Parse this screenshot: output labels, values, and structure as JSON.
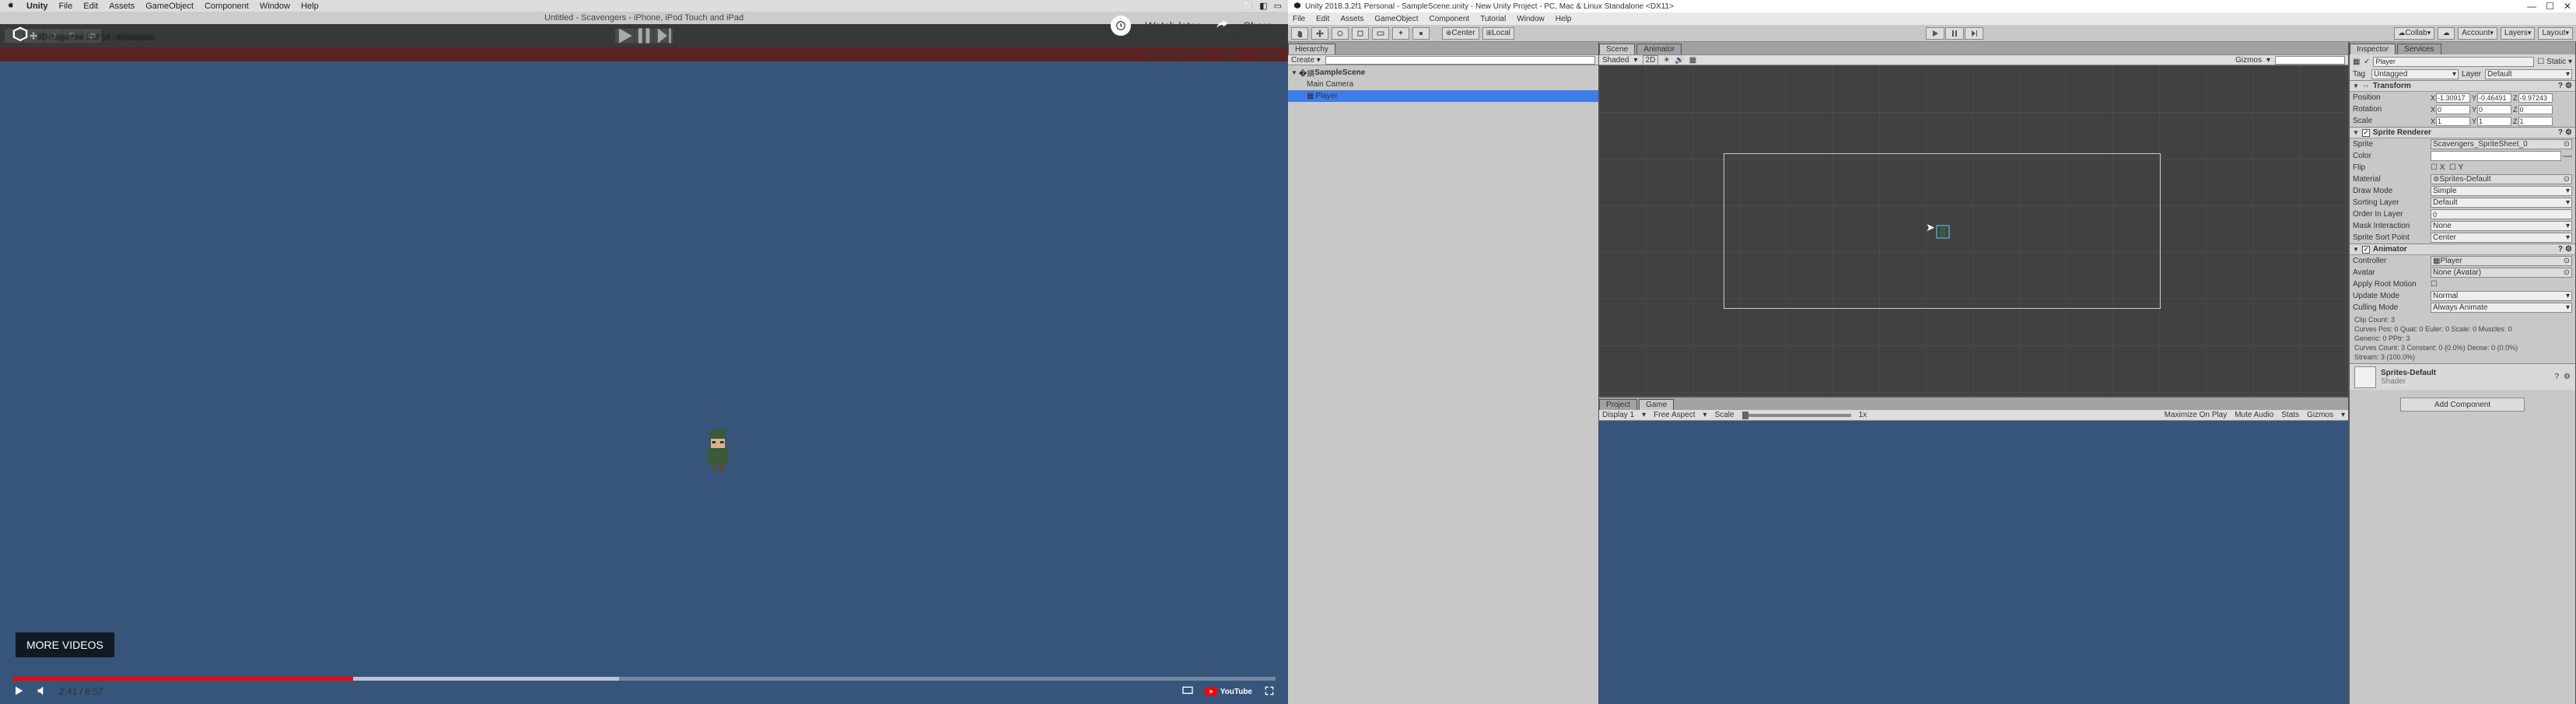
{
  "mac_menu": {
    "app": "Unity",
    "items": [
      "File",
      "Edit",
      "Assets",
      "GameObject",
      "Component",
      "Window",
      "Help"
    ]
  },
  "mac_doc_title": "Untitled - Scavengers - iPhone, iPod Touch and iPad",
  "video": {
    "title": "2D Roguelike 2 of 14 : Animations",
    "watch_later": "Watch later",
    "share": "Share",
    "more_videos": "MORE VIDEOS",
    "time": "2:41 / 8:57",
    "youtube": "YouTube"
  },
  "left_toolbar_right": [
    "Layers",
    "Layout"
  ],
  "red_bar": {
    "left": "",
    "right1": "Maximize on Play",
    "right2": "Stats",
    "right3": "Gizmos"
  },
  "win_title": "Unity 2018.3.2f1 Personal - SampleScene.unity - New Unity Project - PC, Mac & Linux Standalone <DX11>",
  "win_menu": [
    "File",
    "Edit",
    "Assets",
    "GameObject",
    "Component",
    "Tutorial",
    "Window",
    "Help"
  ],
  "main_toolbar": {
    "center": "Center",
    "local": "Local",
    "collab": "Collab",
    "account": "Account",
    "layers": "Layers",
    "layout": "Layout"
  },
  "hierarchy": {
    "tab": "Hierarchy",
    "create": "Create",
    "scene": "SampleScene",
    "items": [
      "Main Camera",
      "Player"
    ]
  },
  "scene_tabs": {
    "scene": "Scene",
    "animator": "Animator"
  },
  "scene_toolbar": {
    "shaded": "Shaded",
    "twod": "2D",
    "gizmos": "Gizmos"
  },
  "project_tabs": {
    "project": "Project",
    "game": "Game"
  },
  "game_toolbar": {
    "display": "Display 1",
    "aspect": "Free Aspect",
    "scale": "Scale",
    "scale_val": "1x",
    "max": "Maximize On Play",
    "mute": "Mute Audio",
    "stats": "Stats",
    "gizmos": "Gizmos"
  },
  "inspector": {
    "tabs": {
      "inspector": "Inspector",
      "services": "Services"
    },
    "go_name": "Player",
    "static": "Static",
    "tag_label": "Tag",
    "tag_value": "Untagged",
    "layer_label": "Layer",
    "layer_value": "Default",
    "transform": {
      "title": "Transform",
      "position": "Position",
      "pos": {
        "x": "-1.30917",
        "y": "-0.46491",
        "z": "-9.97243"
      },
      "rotation": "Rotation",
      "rot": {
        "x": "0",
        "y": "0",
        "z": "0"
      },
      "scale": "Scale",
      "scl": {
        "x": "1",
        "y": "1",
        "z": "1"
      }
    },
    "sprite_renderer": {
      "title": "Sprite Renderer",
      "sprite": "Sprite",
      "sprite_val": "Scavengers_SpriteSheet_0",
      "color": "Color",
      "flip": "Flip",
      "flip_x": "X",
      "flip_y": "Y",
      "material": "Material",
      "material_val": "Sprites-Default",
      "draw_mode": "Draw Mode",
      "draw_mode_val": "Simple",
      "sorting_layer": "Sorting Layer",
      "sorting_layer_val": "Default",
      "order": "Order In Layer",
      "order_val": "0",
      "mask": "Mask Interaction",
      "mask_val": "None",
      "sort_point": "Sprite Sort Point",
      "sort_point_val": "Center"
    },
    "animator": {
      "title": "Animator",
      "controller": "Controller",
      "controller_val": "Player",
      "avatar": "Avatar",
      "avatar_val": "None (Avatar)",
      "root": "Apply Root Motion",
      "update": "Update Mode",
      "update_val": "Normal",
      "culling": "Culling Mode",
      "culling_val": "Always Animate",
      "stats": "Clip Count: 3\nCurves Pos: 0 Quat: 0 Euler: 0 Scale: 0 Muscles: 0\nGeneric: 0 PPtr: 3\nCurves Count: 3 Constant: 0 (0.0%) Dense: 0 (0.0%)\nStream: 3 (100.0%)"
    },
    "material_slot": {
      "name": "Sprites-Default",
      "shader": "Shader"
    },
    "add_component": "Add Component"
  }
}
